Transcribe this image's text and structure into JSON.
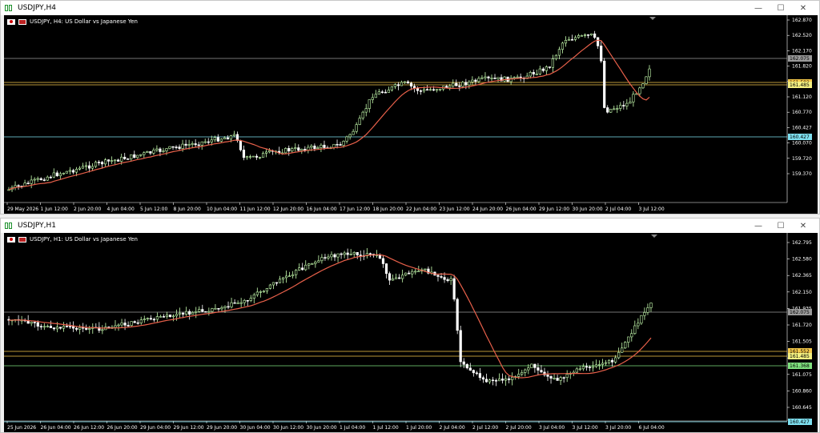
{
  "colors": {
    "bull": "#c8ffb0",
    "bear": "#ffffff",
    "ma": "#e8604a",
    "grid": "#888888",
    "level_hi": "#f4c84a",
    "level_mid": "#f4c84a",
    "level_lo": "#7ee0f0",
    "level_green": "#7ee07e"
  },
  "window1": {
    "title": "USDJPY,H4",
    "symbol_label": "USDJPY, H4:  US Dollar vs Japanese Yen",
    "price_ticks": [
      "162.870",
      "162.520",
      "162.170",
      "161.820",
      "161.485",
      "161.120",
      "160.770",
      "160.427",
      "160.070",
      "159.720",
      "159.370"
    ],
    "price_tags": {
      "current": "162.075",
      "yellow1": "161.582",
      "yellow2": "161.485",
      "cyan": "160.427"
    },
    "time_ticks": [
      "29 May 2026",
      "1 Jun 12:00",
      "2 Jun 20:00",
      "4 Jun 04:00",
      "5 Jun 12:00",
      "8 Jun 20:00",
      "10 Jun 04:00",
      "11 Jun 12:00",
      "12 Jun 20:00",
      "16 Jun 04:00",
      "17 Jun 12:00",
      "18 Jun 20:00",
      "22 Jun 04:00",
      "23 Jun 12:00",
      "24 Jun 20:00",
      "26 Jun 04:00",
      "29 Jun 12:00",
      "30 Jun 20:00",
      "2 Jul 04:00",
      "3 Jul 12:00"
    ]
  },
  "window2": {
    "title": "USDJPY,H1",
    "symbol_label": "USDJPY, H1:  US Dollar vs Japanese Yen",
    "price_ticks": [
      "162.795",
      "162.580",
      "162.365",
      "162.150",
      "161.935",
      "161.720",
      "161.505",
      "161.290",
      "161.075",
      "160.860",
      "160.645"
    ],
    "price_tags": {
      "current": "162.075",
      "yellow1": "161.552",
      "yellow2": "161.485",
      "green": "161.368",
      "cyan": "160.427"
    },
    "time_ticks": [
      "25 Jun 2026",
      "26 Jun 04:00",
      "26 Jun 12:00",
      "26 Jun 20:00",
      "29 Jun 04:00",
      "29 Jun 12:00",
      "29 Jun 20:00",
      "30 Jun 04:00",
      "30 Jun 12:00",
      "30 Jun 20:00",
      "1 Jul 04:00",
      "1 Jul 12:00",
      "1 Jul 20:00",
      "2 Jul 04:00",
      "2 Jul 12:00",
      "2 Jul 20:00",
      "3 Jul 04:00",
      "3 Jul 12:00",
      "3 Jul 20:00",
      "6 Jul 04:00"
    ]
  }
}
